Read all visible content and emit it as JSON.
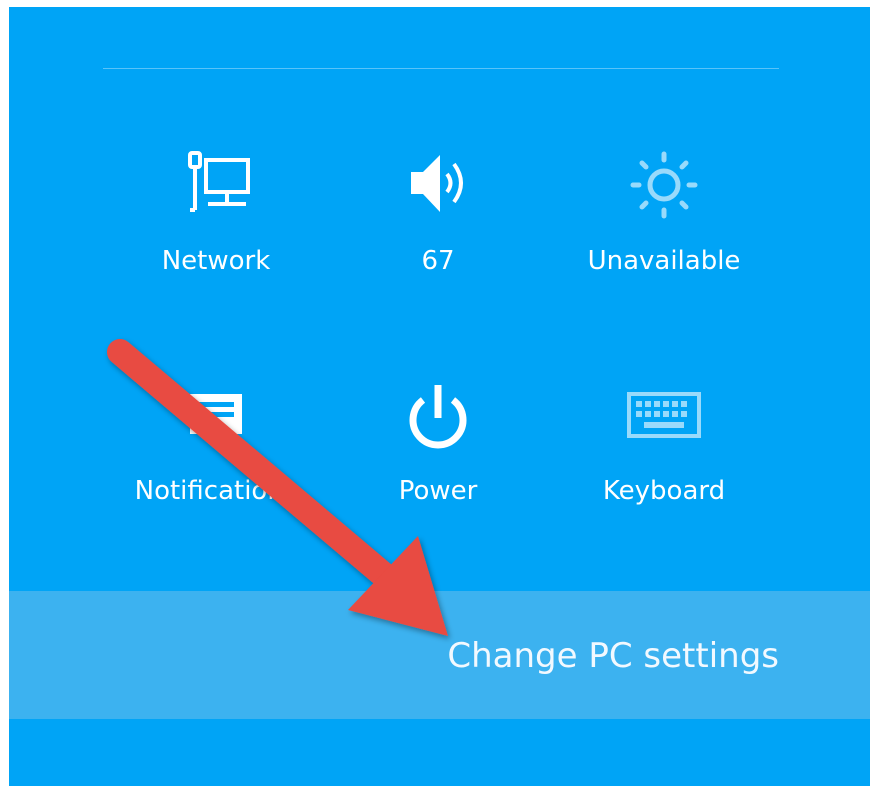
{
  "quick_settings": [
    {
      "id": "network",
      "label": "Network",
      "icon": "network-icon"
    },
    {
      "id": "volume",
      "label": "67",
      "icon": "speaker-icon"
    },
    {
      "id": "brightness",
      "label": "Unavailable",
      "icon": "brightness-icon"
    },
    {
      "id": "notifications",
      "label": "Notifications",
      "icon": "notifications-icon"
    },
    {
      "id": "power",
      "label": "Power",
      "icon": "power-icon"
    },
    {
      "id": "keyboard",
      "label": "Keyboard",
      "icon": "keyboard-icon"
    }
  ],
  "change_pc_settings": {
    "label": "Change PC settings"
  },
  "annotation": {
    "icon": "arrow-annotation",
    "color": "#e84b42"
  },
  "colors": {
    "panel": "#00a4f6",
    "highlight_bar": "#3cb2f0",
    "text": "#ffffff"
  }
}
